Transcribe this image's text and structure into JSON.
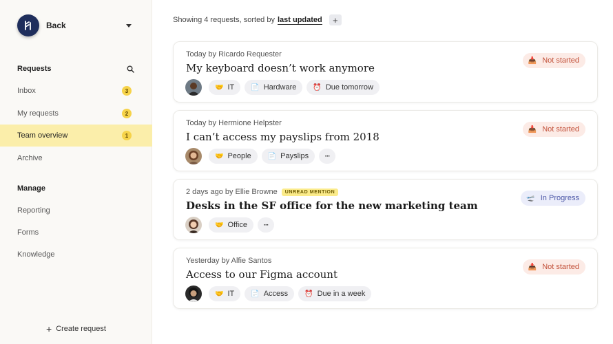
{
  "sidebar": {
    "workspace_name": "Back",
    "requests_section": "Requests",
    "manage_section": "Manage",
    "items": [
      {
        "label": "Inbox",
        "count": "3"
      },
      {
        "label": "My requests",
        "count": "2"
      },
      {
        "label": "Team overview",
        "count": "1"
      },
      {
        "label": "Archive",
        "count": ""
      }
    ],
    "manage_items": [
      {
        "label": "Reporting"
      },
      {
        "label": "Forms"
      },
      {
        "label": "Knowledge"
      }
    ],
    "create_label": "Create request"
  },
  "topbar": {
    "summary": "Showing 4 requests, sorted by",
    "sort_label": "last updated",
    "add_label": "+"
  },
  "requests": [
    {
      "meta": "Today by Ricardo Requester",
      "title": "My keyboard doesn’t work anymore",
      "tags": [
        "IT",
        "Hardware",
        "Due tomorrow"
      ],
      "status": "Not started"
    },
    {
      "meta": "Today by Hermione Helpster",
      "title": "I can’t access my payslips from 2018",
      "tags": [
        "People",
        "Payslips"
      ],
      "more": "···",
      "status": "Not started"
    },
    {
      "meta": "2 days ago by Ellie Browne",
      "badge": "UNREAD MENTION",
      "title": "Desks in the SF office for the new marketing team",
      "tags": [
        "Office"
      ],
      "more": "···",
      "status": "In Progress"
    },
    {
      "meta": "Yesterday by Alfie Santos",
      "title": "Access to our Figma account",
      "tags": [
        "IT",
        "Access",
        "Due in a week"
      ],
      "status": "Not started"
    }
  ],
  "icons": {
    "team": "handshake-icon",
    "category": "document-icon",
    "due": "alarm-clock-icon",
    "not_started": "inbox-tray-icon",
    "in_progress": "progress-icon"
  },
  "colors": {
    "active_nav": "#fbeeaa",
    "badge": "#f6d34a",
    "not_started": "#c2513a",
    "in_progress": "#4b56a6",
    "logo": "#1f2e5c"
  }
}
